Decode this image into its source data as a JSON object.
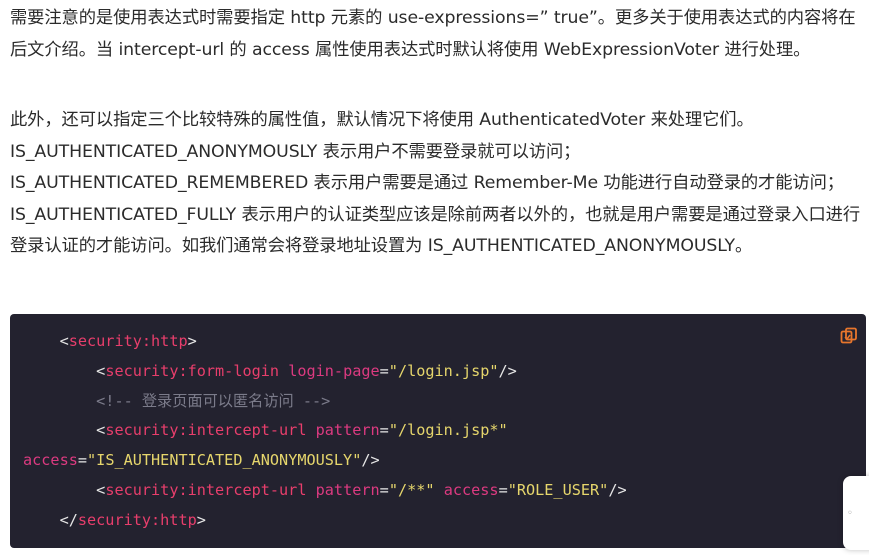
{
  "paragraph1": "需要注意的是使用表达式时需要指定 http 元素的 use-expressions=” true”。更多关于使用表达式的内容将在后文介绍。当 intercept-url 的 access 属性使用表达式时默认将使用 WebExpressionVoter 进行处理。",
  "paragraph2": "此外，还可以指定三个比较特殊的属性值，默认情况下将使用 AuthenticatedVoter 来处理它们。IS_AUTHENTICATED_ANONYMOUSLY 表示用户不需要登录就可以访问；IS_AUTHENTICATED_REMEMBERED 表示用户需要是通过 Remember-Me 功能进行自动登录的才能访问；IS_AUTHENTICATED_FULLY 表示用户的认证类型应该是除前两者以外的，也就是用户需要是通过登录入口进行登录认证的才能访问。如我们通常会将登录地址设置为 IS_AUTHENTICATED_ANONYMOUSLY。",
  "code": {
    "line1_tag": "security:http",
    "line2_tag": "security:form-login",
    "line2_attr": "login-page",
    "line2_val": "\"/login.jsp\"",
    "line3_comment": "<!-- 登录页面可以匿名访问 -->",
    "line4_tag": "security:intercept-url",
    "line4_attr": "pattern",
    "line4_val": "\"/login.jsp*\"",
    "line5_attr": "access",
    "line5_val": "\"IS_AUTHENTICATED_ANONYMOUSLY\"",
    "line6_tag": "security:intercept-url",
    "line6_attr1": "pattern",
    "line6_val1": "\"/**\"",
    "line6_attr2": "access",
    "line6_val2": "\"ROLE_USER\"",
    "line7_tag": "security:http"
  },
  "icons": {
    "copy": "copy-icon"
  },
  "colors": {
    "code_bg": "#23222f",
    "tag": "#e83e6c",
    "string": "#e6d66c",
    "comment": "#7b7b8a",
    "copy_icon": "#e8762c"
  }
}
